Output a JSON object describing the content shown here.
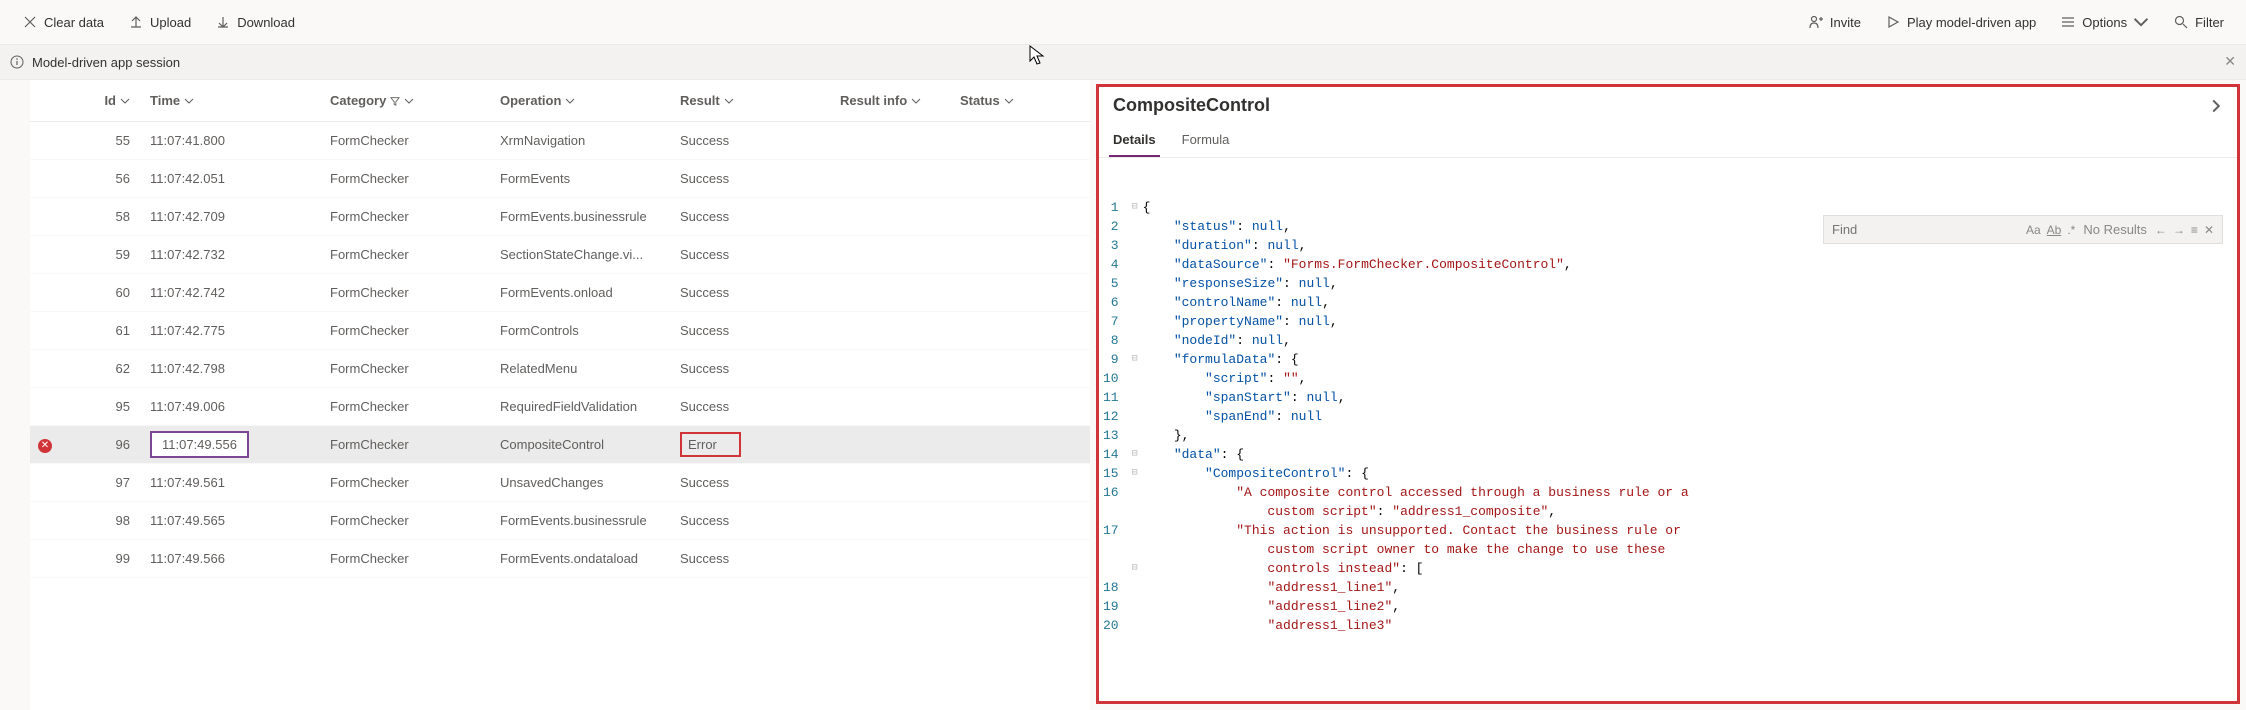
{
  "toolbar": {
    "clear": "Clear data",
    "upload": "Upload",
    "download": "Download",
    "invite": "Invite",
    "play": "Play model-driven app",
    "options": "Options",
    "filter": "Filter"
  },
  "session": {
    "label": "Model-driven app session"
  },
  "columns": {
    "id": "Id",
    "time": "Time",
    "category": "Category",
    "operation": "Operation",
    "result": "Result",
    "resultinfo": "Result info",
    "status": "Status"
  },
  "rows": [
    {
      "id": "55",
      "time": "11:07:41.800",
      "category": "FormChecker",
      "operation": "XrmNavigation",
      "result": "Success"
    },
    {
      "id": "56",
      "time": "11:07:42.051",
      "category": "FormChecker",
      "operation": "FormEvents",
      "result": "Success"
    },
    {
      "id": "58",
      "time": "11:07:42.709",
      "category": "FormChecker",
      "operation": "FormEvents.businessrule",
      "result": "Success"
    },
    {
      "id": "59",
      "time": "11:07:42.732",
      "category": "FormChecker",
      "operation": "SectionStateChange.vi...",
      "result": "Success"
    },
    {
      "id": "60",
      "time": "11:07:42.742",
      "category": "FormChecker",
      "operation": "FormEvents.onload",
      "result": "Success"
    },
    {
      "id": "61",
      "time": "11:07:42.775",
      "category": "FormChecker",
      "operation": "FormControls",
      "result": "Success"
    },
    {
      "id": "62",
      "time": "11:07:42.798",
      "category": "FormChecker",
      "operation": "RelatedMenu",
      "result": "Success"
    },
    {
      "id": "95",
      "time": "11:07:49.006",
      "category": "FormChecker",
      "operation": "RequiredFieldValidation",
      "result": "Success"
    },
    {
      "id": "96",
      "time": "11:07:49.556",
      "category": "FormChecker",
      "operation": "CompositeControl",
      "result": "Error",
      "error": true,
      "selected": true
    },
    {
      "id": "97",
      "time": "11:07:49.561",
      "category": "FormChecker",
      "operation": "UnsavedChanges",
      "result": "Success"
    },
    {
      "id": "98",
      "time": "11:07:49.565",
      "category": "FormChecker",
      "operation": "FormEvents.businessrule",
      "result": "Success"
    },
    {
      "id": "99",
      "time": "11:07:49.566",
      "category": "FormChecker",
      "operation": "FormEvents.ondataload",
      "result": "Success"
    }
  ],
  "detail": {
    "title": "CompositeControl",
    "tabs": {
      "details": "Details",
      "formula": "Formula"
    },
    "find": {
      "placeholder": "Find",
      "noresults": "No Results"
    },
    "code_lines": [
      {
        "n": 1,
        "fold": "-",
        "tokens": [
          {
            "t": "{",
            "c": "p"
          }
        ]
      },
      {
        "n": 2,
        "tokens": [
          {
            "t": "    ",
            "c": "p"
          },
          {
            "t": "\"status\"",
            "c": "k"
          },
          {
            "t": ": ",
            "c": "p"
          },
          {
            "t": "null",
            "c": "n"
          },
          {
            "t": ",",
            "c": "p"
          }
        ]
      },
      {
        "n": 3,
        "tokens": [
          {
            "t": "    ",
            "c": "p"
          },
          {
            "t": "\"duration\"",
            "c": "k"
          },
          {
            "t": ": ",
            "c": "p"
          },
          {
            "t": "null",
            "c": "n"
          },
          {
            "t": ",",
            "c": "p"
          }
        ]
      },
      {
        "n": 4,
        "tokens": [
          {
            "t": "    ",
            "c": "p"
          },
          {
            "t": "\"dataSource\"",
            "c": "k"
          },
          {
            "t": ": ",
            "c": "p"
          },
          {
            "t": "\"Forms.FormChecker.CompositeControl\"",
            "c": "s"
          },
          {
            "t": ",",
            "c": "p"
          }
        ]
      },
      {
        "n": 5,
        "tokens": [
          {
            "t": "    ",
            "c": "p"
          },
          {
            "t": "\"responseSize\"",
            "c": "k"
          },
          {
            "t": ": ",
            "c": "p"
          },
          {
            "t": "null",
            "c": "n"
          },
          {
            "t": ",",
            "c": "p"
          }
        ]
      },
      {
        "n": 6,
        "tokens": [
          {
            "t": "    ",
            "c": "p"
          },
          {
            "t": "\"controlName\"",
            "c": "k"
          },
          {
            "t": ": ",
            "c": "p"
          },
          {
            "t": "null",
            "c": "n"
          },
          {
            "t": ",",
            "c": "p"
          }
        ]
      },
      {
        "n": 7,
        "tokens": [
          {
            "t": "    ",
            "c": "p"
          },
          {
            "t": "\"propertyName\"",
            "c": "k"
          },
          {
            "t": ": ",
            "c": "p"
          },
          {
            "t": "null",
            "c": "n"
          },
          {
            "t": ",",
            "c": "p"
          }
        ]
      },
      {
        "n": 8,
        "tokens": [
          {
            "t": "    ",
            "c": "p"
          },
          {
            "t": "\"nodeId\"",
            "c": "k"
          },
          {
            "t": ": ",
            "c": "p"
          },
          {
            "t": "null",
            "c": "n"
          },
          {
            "t": ",",
            "c": "p"
          }
        ]
      },
      {
        "n": 9,
        "fold": "-",
        "tokens": [
          {
            "t": "    ",
            "c": "p"
          },
          {
            "t": "\"formulaData\"",
            "c": "k"
          },
          {
            "t": ": {",
            "c": "p"
          }
        ]
      },
      {
        "n": 10,
        "tokens": [
          {
            "t": "        ",
            "c": "p"
          },
          {
            "t": "\"script\"",
            "c": "k"
          },
          {
            "t": ": ",
            "c": "p"
          },
          {
            "t": "\"\"",
            "c": "s"
          },
          {
            "t": ",",
            "c": "p"
          }
        ]
      },
      {
        "n": 11,
        "tokens": [
          {
            "t": "        ",
            "c": "p"
          },
          {
            "t": "\"spanStart\"",
            "c": "k"
          },
          {
            "t": ": ",
            "c": "p"
          },
          {
            "t": "null",
            "c": "n"
          },
          {
            "t": ",",
            "c": "p"
          }
        ]
      },
      {
        "n": 12,
        "tokens": [
          {
            "t": "        ",
            "c": "p"
          },
          {
            "t": "\"spanEnd\"",
            "c": "k"
          },
          {
            "t": ": ",
            "c": "p"
          },
          {
            "t": "null",
            "c": "n"
          }
        ]
      },
      {
        "n": 13,
        "tokens": [
          {
            "t": "    },",
            "c": "p"
          }
        ]
      },
      {
        "n": 14,
        "fold": "-",
        "tokens": [
          {
            "t": "    ",
            "c": "p"
          },
          {
            "t": "\"data\"",
            "c": "k"
          },
          {
            "t": ": {",
            "c": "p"
          }
        ]
      },
      {
        "n": 15,
        "fold": "-",
        "tokens": [
          {
            "t": "        ",
            "c": "p"
          },
          {
            "t": "\"CompositeControl\"",
            "c": "k"
          },
          {
            "t": ": {",
            "c": "p"
          }
        ]
      },
      {
        "n": 16,
        "tokens": [
          {
            "t": "            ",
            "c": "p"
          },
          {
            "t": "\"A composite control accessed through a business rule or a",
            "c": "s"
          }
        ]
      },
      {
        "n": "",
        "tokens": [
          {
            "t": "                custom script\"",
            "c": "s"
          },
          {
            "t": ": ",
            "c": "p"
          },
          {
            "t": "\"address1_composite\"",
            "c": "s"
          },
          {
            "t": ",",
            "c": "p"
          }
        ]
      },
      {
        "n": 17,
        "tokens": [
          {
            "t": "            ",
            "c": "p"
          },
          {
            "t": "\"This action is unsupported. Contact the business rule or",
            "c": "s"
          }
        ]
      },
      {
        "n": "",
        "tokens": [
          {
            "t": "                custom script owner to make the change to use these",
            "c": "s"
          }
        ]
      },
      {
        "n": "",
        "fold": "-",
        "tokens": [
          {
            "t": "                controls instead\"",
            "c": "s"
          },
          {
            "t": ": [",
            "c": "p"
          }
        ]
      },
      {
        "n": 18,
        "tokens": [
          {
            "t": "                ",
            "c": "p"
          },
          {
            "t": "\"address1_line1\"",
            "c": "s"
          },
          {
            "t": ",",
            "c": "p"
          }
        ]
      },
      {
        "n": 19,
        "tokens": [
          {
            "t": "                ",
            "c": "p"
          },
          {
            "t": "\"address1_line2\"",
            "c": "s"
          },
          {
            "t": ",",
            "c": "p"
          }
        ]
      },
      {
        "n": 20,
        "tokens": [
          {
            "t": "                ",
            "c": "p"
          },
          {
            "t": "\"address1_line3\"",
            "c": "s"
          }
        ]
      }
    ]
  }
}
